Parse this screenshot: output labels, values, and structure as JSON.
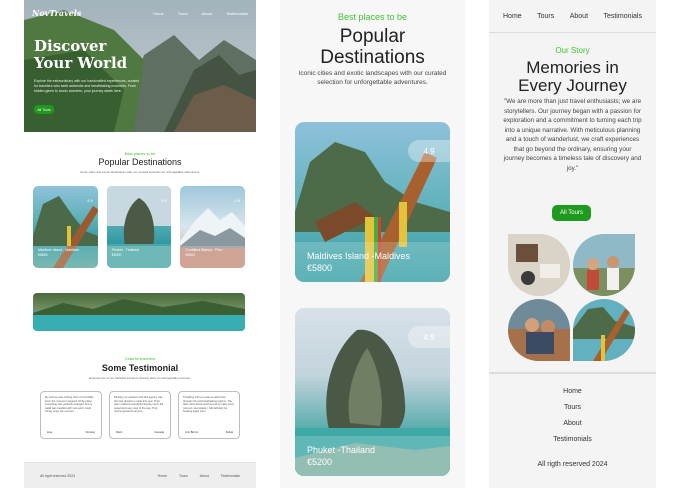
{
  "panel1": {
    "brand": "NovTravels",
    "nav": [
      "Home",
      "Tours",
      "About",
      "Testimonials"
    ],
    "hero_title_1": "Discover",
    "hero_title_2": "Your World",
    "hero_text": "Explore the extraordinary with our handcrafted experiences, curated for travelers who seek authentic and breathtaking moments. From hidden gems to iconic wonders, your journey starts here.",
    "hero_button": "All Tours",
    "dest_kicker": "Best places to be",
    "dest_title": "Popular Destinations",
    "dest_sub": "Iconic cities and exotic landscapes with our curated selection for unforgettable adventures.",
    "cards": [
      {
        "rating": "4.9",
        "name": "Maldives Island - Maldives",
        "price": "€5800"
      },
      {
        "rating": "4.9",
        "name": "Phuket - Thailand",
        "price": "€5200"
      },
      {
        "rating": "4.8",
        "name": "Cordillera Blanca - Peru",
        "price": "€4600"
      }
    ],
    "testi_kicker": "Grateful travelers",
    "testi_title": "Some Testimonial",
    "testi_sub": "Experiences of our satisfied travelers sharing tales of unforgettable journeys.",
    "testimonials": [
      {
        "text": "My journey was nothing short of incredible. From the moment I stepped off the plane, everything was perfectly arranged. Every detail was handled with care and I could simply enjoy the moment.",
        "name": "Lisa",
        "place": "Norway"
      },
      {
        "text": "Booking my vacation with this agency was the best decision I made this year. Their team crafted a wonderful itinerary and I felt supported every step of the way. Truly recommended to anyone.",
        "name": "Marc",
        "place": "Canada"
      },
      {
        "text": "Travelling with you was an adventure through rich and breathtaking regions. The team went above and beyond to make every moment memorable. I will definitely be booking again soon.",
        "name": "Ann Burns",
        "place": "Dubai"
      }
    ],
    "footer_copy": "All right reserved 2024",
    "footer_links": [
      "Home",
      "Tours",
      "About",
      "Testimonials"
    ]
  },
  "panel2": {
    "kicker": "Best places to be",
    "title_1": "Popular",
    "title_2": "Destinations",
    "subtitle": "Iconic cities and exotic landscapes with our curated selection for unforgettable adventures.",
    "cards": [
      {
        "rating": "4.9",
        "name": "Maldives Island -Maldives",
        "price": "€5800"
      },
      {
        "rating": "4.9",
        "name": "Phuket -Thailand",
        "price": "€5200"
      }
    ]
  },
  "panel3": {
    "nav": [
      "Home",
      "Tours",
      "About",
      "Testimonials"
    ],
    "kicker": "Our Story",
    "title_1": "Memories in",
    "title_2": "Every Journey",
    "story": "\"We are more than just travel enthusiasts; we are storytellers. Our journey began with a passion for exploration and a commitment to turning each trip into a unique narrative. With meticulous planning and a touch of wanderlust, we craft experiences that go beyond the ordinary, ensuring your journey becomes a timeless tale of discovery and joy.\"",
    "button": "All Tours",
    "footer_links": [
      "Home",
      "Tours",
      "About",
      "Testimonials"
    ],
    "footer_copy": "All rigth reserved 2024"
  },
  "colors": {
    "accent_green": "#1e9a1e",
    "kicker_green": "#42c233"
  }
}
